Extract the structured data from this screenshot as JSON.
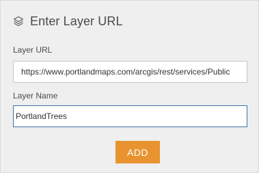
{
  "panel": {
    "title": "Enter Layer URL",
    "title_icon": "layers-icon"
  },
  "form": {
    "url_label": "Layer URL",
    "url_value": "https://www.portlandmaps.com/arcgis/rest/services/Public",
    "name_label": "Layer Name",
    "name_value": "PortlandTrees",
    "add_label": "ADD"
  },
  "colors": {
    "button_accent": "#e8932f",
    "panel_background": "#efefef",
    "focus_border": "#3b6ea8"
  }
}
